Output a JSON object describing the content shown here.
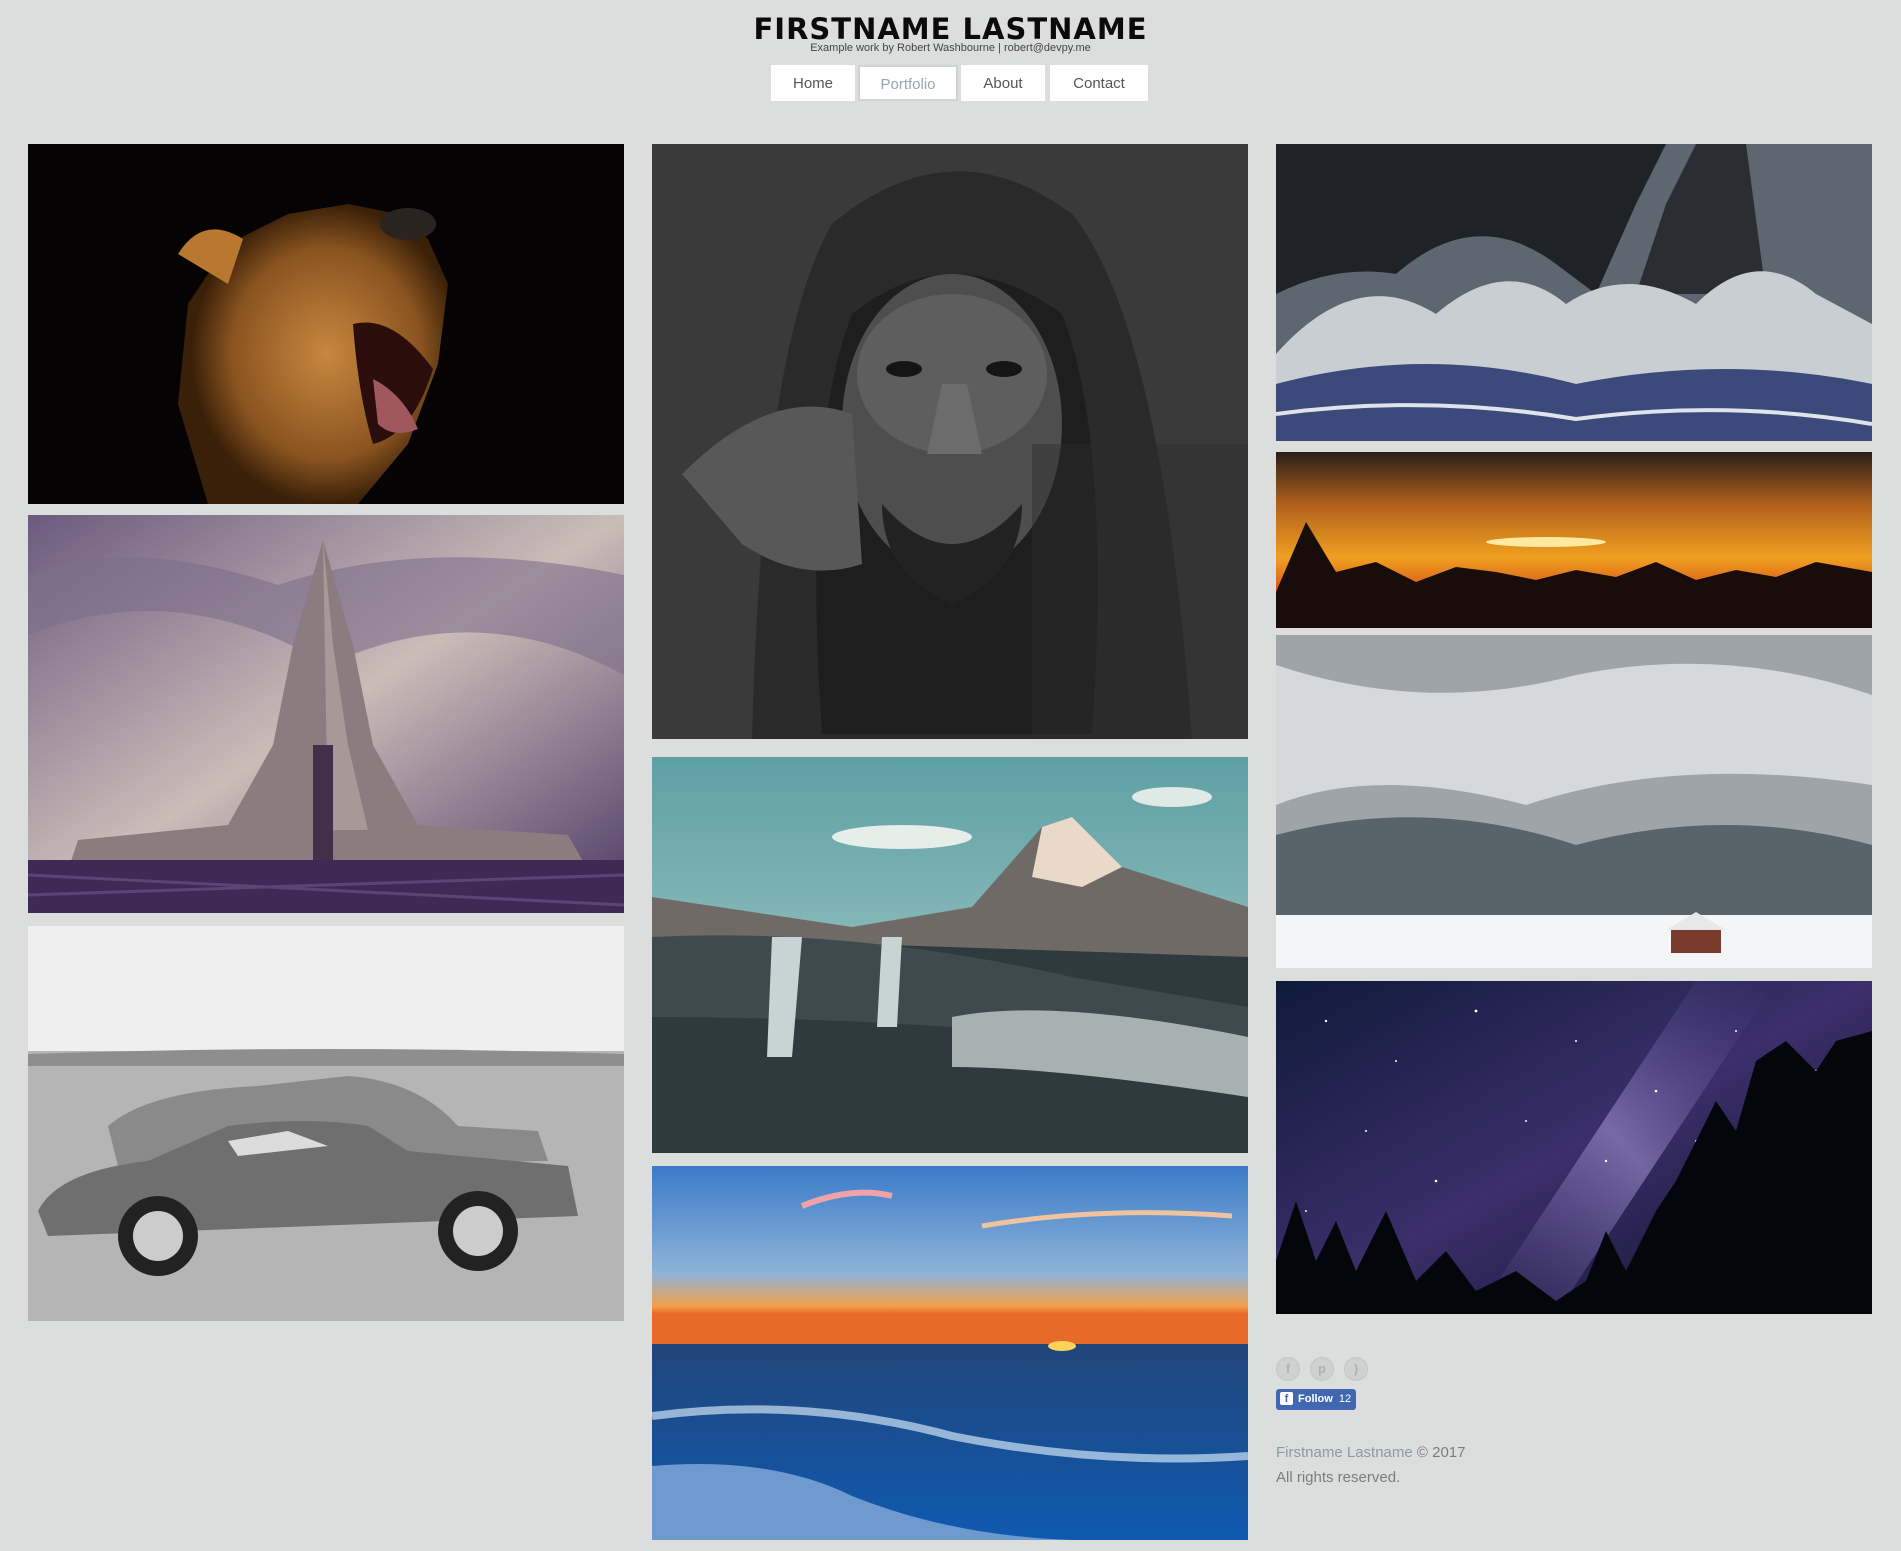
{
  "site": {
    "title": "FIRSTNAME LASTNAME",
    "tagline": "Example work by Robert Washbourne | robert@devpy.me"
  },
  "nav": {
    "active": "Portfolio",
    "items": [
      "Home",
      "Portfolio",
      "About",
      "Contact"
    ]
  },
  "gallery": {
    "photos": [
      {
        "subject": "lioness yawning"
      },
      {
        "subject": "hallgrimskirkja church"
      },
      {
        "subject": "vintage cars black and white"
      },
      {
        "subject": "hooded man portrait"
      },
      {
        "subject": "kirkjufell mountain waterfall"
      },
      {
        "subject": "ocean sunset"
      },
      {
        "subject": "stormy waves"
      },
      {
        "subject": "orange sunset over trees"
      },
      {
        "subject": "snowy mountain with cabin"
      },
      {
        "subject": "milky way over forest"
      }
    ]
  },
  "footer": {
    "social_icons": [
      "facebook-icon",
      "pinterest-icon",
      "rss-icon"
    ],
    "fb_follow_label": "Follow",
    "fb_follow_count": "12",
    "copyright_name": "Firstname Lastname",
    "copyright_year": "© 2017",
    "rights": "All rights reserved."
  },
  "colors": {
    "background": "#dcdedd",
    "nav_active": "#9aa6ad",
    "link": "#8a9ba4",
    "facebook": "#4267b2"
  }
}
